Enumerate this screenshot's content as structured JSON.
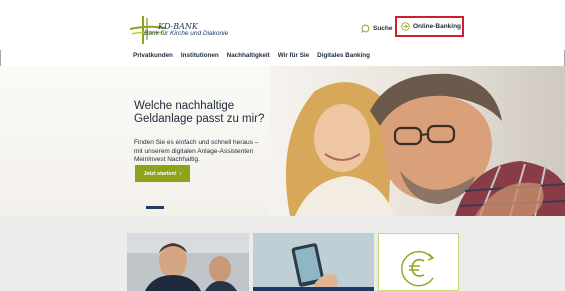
{
  "header": {
    "logo": {
      "name": "KD-BANK",
      "subtitle": "Bank für Kirche und Diakonie"
    },
    "search_label": "Suche",
    "online_banking_label": "Online-Banking"
  },
  "nav": {
    "items": [
      "Privatkunden",
      "Institutionen",
      "Nachhaltigkeit",
      "Wir für Sie",
      "Digitales Banking"
    ]
  },
  "hero": {
    "title_line1": "Welche nachhaltige",
    "title_line2": "Geldanlage passt zu mir?",
    "body": "Finden Sie es einfach und schnell heraus – mit unserem digitalen Anlage-Assistenten MeinInvest Nachhaltig.",
    "cta_label": "Jetzt starten!",
    "cta_arrow": "›"
  },
  "icons": {
    "search": "search-icon",
    "online_banking": "login-arrow-icon",
    "euro": "euro-icon"
  },
  "colors": {
    "brand_green": "#8fa31d",
    "brand_navy": "#1e3a66",
    "highlight_red": "#cf1f2e"
  }
}
